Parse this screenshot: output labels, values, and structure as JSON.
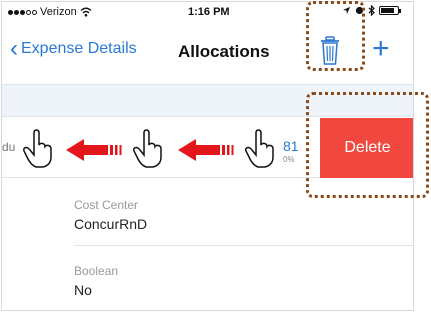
{
  "status_bar": {
    "carrier": "Verizon",
    "time": "1:16 PM"
  },
  "nav": {
    "back_label": "Expense Details",
    "title": "Allocations"
  },
  "row": {
    "cut_text": "du",
    "amount": "81",
    "percent": "0%",
    "delete_label": "Delete"
  },
  "fields": [
    {
      "label": "Cost Center",
      "value": "ConcurRnD"
    },
    {
      "label": "Boolean",
      "value": "No"
    }
  ],
  "colors": {
    "accent": "#2a78d4",
    "delete": "#f0483e",
    "arrow": "#e3161b",
    "highlight": "#8a4a1a"
  },
  "icons": [
    "wifi-icon",
    "location-icon",
    "bluetooth-icon",
    "battery-icon",
    "back-chevron-icon",
    "trash-icon",
    "plus-icon",
    "pointing-hand-icon",
    "left-arrow-icon"
  ]
}
